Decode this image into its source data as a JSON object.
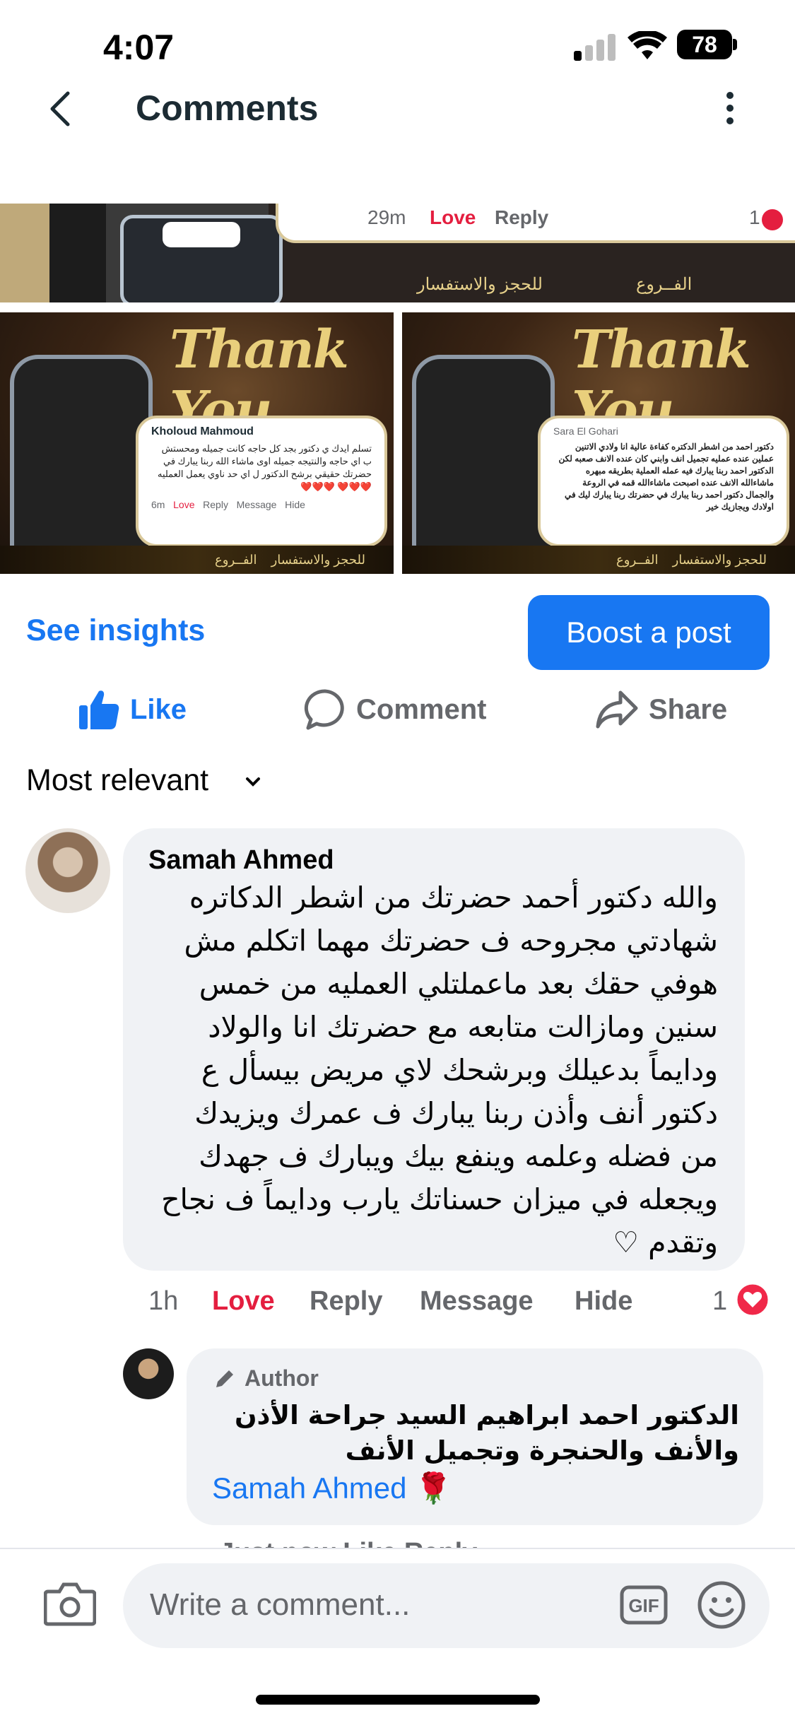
{
  "status_bar": {
    "time": "4:07",
    "battery": "78"
  },
  "header": {
    "title": "Comments"
  },
  "images": {
    "top_strip": {
      "time": "29m",
      "love": "Love",
      "reply": "Reply",
      "count": "1",
      "footer_text": "للحجز والاستفسار",
      "footer_branch": "الفــروع"
    },
    "left": {
      "banner": "Thank You",
      "name": "Kholoud Mahmoud",
      "text": "تسلم ايدك ي دكتور بجد كل حاجه كانت جميله ومحستش ب اي حاجه والنتيجه جميله اوى ماشاء الله ربنا يبارك في حضرتك حقيقي برشح الدكتور ل اي حد ناوي يعمل العمليه ❤️❤️❤️ ❤️❤️❤️",
      "meta_time": "6m",
      "meta_love": "Love",
      "meta_reply": "Reply",
      "meta_message": "Message",
      "meta_hide": "Hide",
      "footer_text": "للحجز والاستفسار",
      "footer_branch": "الفــروع"
    },
    "right": {
      "banner": "Thank You",
      "name": "Sara El Gohari",
      "text": "دكتور احمد من اشطر الدكتره كفاءة عالية انا ولادي الاتنين عملين عنده عمليه تجميل انف وابني كان عنده الانف صعبه لكن الدكتور احمد ربنا يبارك فيه عمله العملية بطريقه مبهره ماشاءالله الانف عنده اصبحت ماشاءالله قمه في الروعة والجمال دكتور احمد ربنا يبارك في حضرتك ربنا يبارك ليك في اولادك ويجازيك خير",
      "footer_text": "للحجز والاستفسار",
      "footer_branch": "الفــروع"
    }
  },
  "insights": {
    "see_insights": "See insights",
    "boost": "Boost a post"
  },
  "actions": {
    "like": "Like",
    "comment": "Comment",
    "share": "Share"
  },
  "sort": {
    "label": "Most relevant"
  },
  "comment": {
    "author": "Samah Ahmed",
    "text": "والله دكتور أحمد حضرتك من اشطر الدكاتره شهادتي مجروحه ف حضرتك مهما اتكلم مش هوفي حقك بعد ماعملتلي العمليه من خمس سنين ومازالت متابعه مع حضرتك انا والولاد ودايماً بدعيلك وبرشحك لاي مريض بيسأل ع دكتور أنف وأذن ربنا يبارك ف عمرك ويزيدك من فضله وعلمه وينفع بيك ويبارك ف جهدك ويجعله في ميزان حسناتك يارب ودايماً ف نجاح وتقدم ♡",
    "time": "1h",
    "love": "Love",
    "reply": "Reply",
    "message": "Message",
    "hide": "Hide",
    "reaction_count": "1"
  },
  "reply": {
    "badge": "Author",
    "text": "الدكتور احمد ابراهيم السيد جراحة الأذن والأنف والحنجرة وتجميل الأنف",
    "mention": "Samah Ahmed",
    "emoji": "🌹",
    "meta_cut": "Just now   Like   Reply"
  },
  "composer": {
    "placeholder": "Write a comment..."
  },
  "colors": {
    "accent": "#1877f2",
    "love": "#e41e3f",
    "muted": "#65676b",
    "bubble": "#f0f2f5"
  }
}
